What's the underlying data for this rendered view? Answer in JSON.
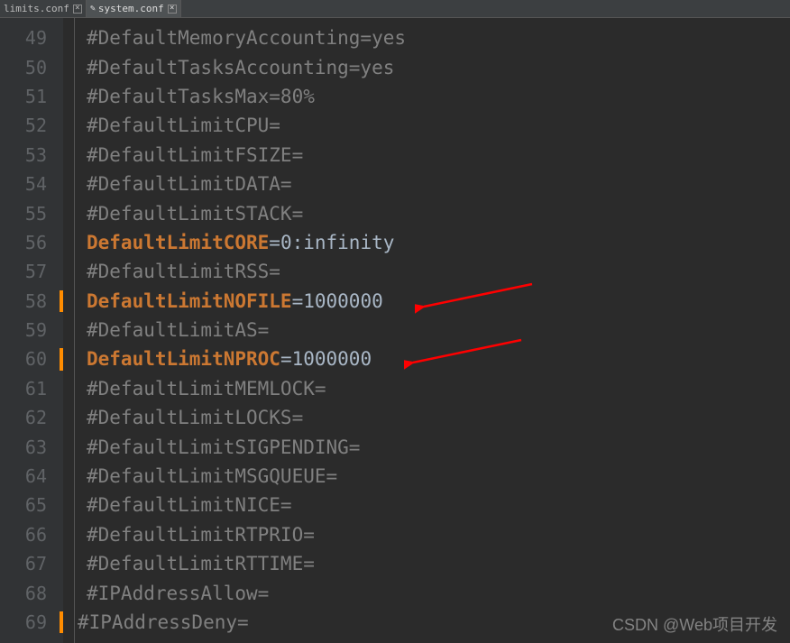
{
  "tabs": [
    {
      "label": "limits.conf",
      "active": false
    },
    {
      "label": "system.conf",
      "active": true,
      "modified": true
    }
  ],
  "gutter": {
    "start": 49,
    "end": 69,
    "modified_lines": [
      58,
      60,
      69
    ]
  },
  "lines": [
    {
      "num": 49,
      "type": "comment",
      "text": "#DefaultMemoryAccounting=yes"
    },
    {
      "num": 50,
      "type": "comment",
      "text": "#DefaultTasksAccounting=yes"
    },
    {
      "num": 51,
      "type": "comment",
      "text": "#DefaultTasksMax=80%"
    },
    {
      "num": 52,
      "type": "comment",
      "text": "#DefaultLimitCPU="
    },
    {
      "num": 53,
      "type": "comment",
      "text": "#DefaultLimitFSIZE="
    },
    {
      "num": 54,
      "type": "comment",
      "text": "#DefaultLimitDATA="
    },
    {
      "num": 55,
      "type": "comment",
      "text": "#DefaultLimitSTACK="
    },
    {
      "num": 56,
      "type": "kv",
      "key": "DefaultLimitCORE",
      "value": "0:infinity"
    },
    {
      "num": 57,
      "type": "comment",
      "text": "#DefaultLimitRSS="
    },
    {
      "num": 58,
      "type": "kv",
      "key": "DefaultLimitNOFILE",
      "value": "1000000"
    },
    {
      "num": 59,
      "type": "comment",
      "text": "#DefaultLimitAS="
    },
    {
      "num": 60,
      "type": "kv",
      "key": "DefaultLimitNPROC",
      "value": "1000000"
    },
    {
      "num": 61,
      "type": "comment",
      "text": "#DefaultLimitMEMLOCK="
    },
    {
      "num": 62,
      "type": "comment",
      "text": "#DefaultLimitLOCKS="
    },
    {
      "num": 63,
      "type": "comment",
      "text": "#DefaultLimitSIGPENDING="
    },
    {
      "num": 64,
      "type": "comment",
      "text": "#DefaultLimitMSGQUEUE="
    },
    {
      "num": 65,
      "type": "comment",
      "text": "#DefaultLimitNICE="
    },
    {
      "num": 66,
      "type": "comment",
      "text": "#DefaultLimitRTPRIO="
    },
    {
      "num": 67,
      "type": "comment",
      "text": "#DefaultLimitRTTIME="
    },
    {
      "num": 68,
      "type": "comment",
      "text": "#IPAddressAllow="
    },
    {
      "num": 69,
      "type": "comment",
      "text": "#IPAddressDeny=",
      "lessindent": true
    }
  ],
  "arrows": [
    {
      "target_line": 58
    },
    {
      "target_line": 60
    }
  ],
  "watermark": "CSDN @Web项目开发"
}
